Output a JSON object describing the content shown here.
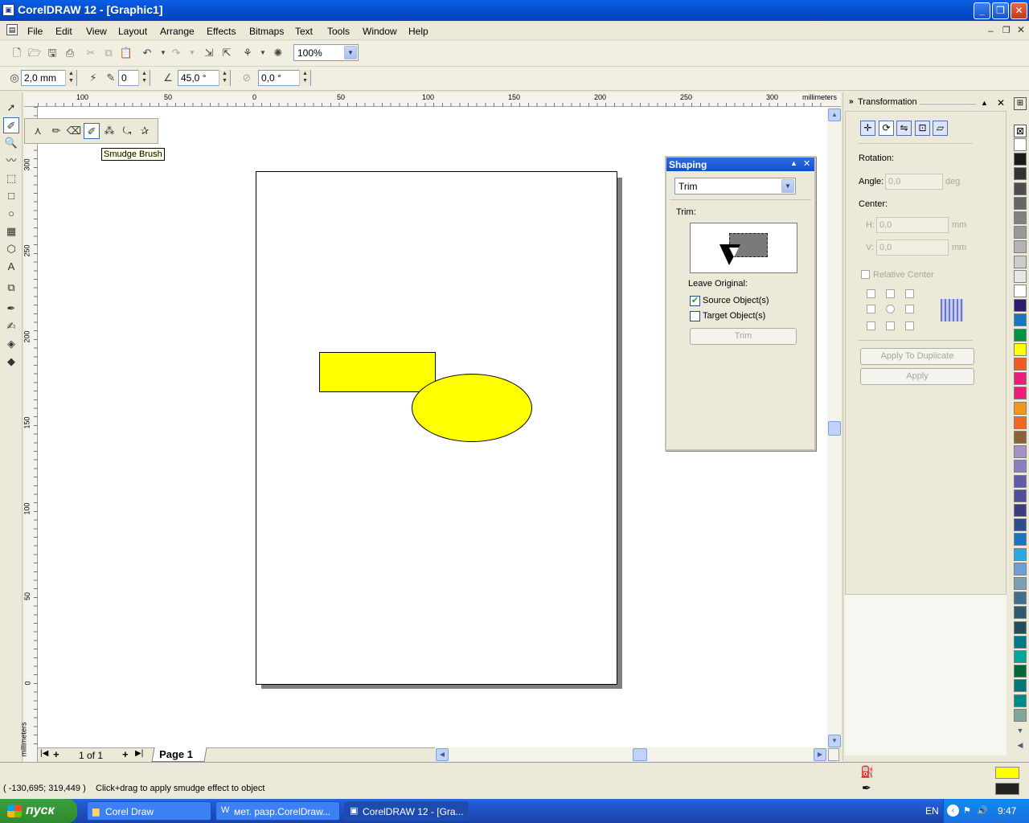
{
  "window": {
    "title": "CorelDRAW 12 - [Graphic1]",
    "min": "_",
    "max": "❐",
    "close": "✕"
  },
  "menu": [
    {
      "label": "File"
    },
    {
      "label": "Edit"
    },
    {
      "label": "View"
    },
    {
      "label": "Layout"
    },
    {
      "label": "Arrange"
    },
    {
      "label": "Effects"
    },
    {
      "label": "Bitmaps"
    },
    {
      "label": "Text"
    },
    {
      "label": "Tools"
    },
    {
      "label": "Window"
    },
    {
      "label": "Help"
    }
  ],
  "standard_toolbar": {
    "zoom_value": "100%"
  },
  "property_bar": {
    "nib_size": "2,0 mm",
    "dryout": "0",
    "tilt": "45,0 °",
    "bearing": "0,0 °"
  },
  "hruler": {
    "ticks": [
      "100",
      "50",
      "0",
      "50",
      "100",
      "150",
      "200",
      "250",
      "300"
    ],
    "units": "millimeters"
  },
  "vruler": {
    "ticks": [
      "300",
      "250",
      "200",
      "150",
      "100",
      "50",
      "0"
    ],
    "units": "millimeters"
  },
  "flyout": {
    "tooltip": "Smudge Brush"
  },
  "shaping": {
    "title": "Shaping",
    "mode": "Trim",
    "section": "Trim:",
    "leave_original": "Leave Original:",
    "source_label": "Source Object(s)",
    "source_checked": true,
    "target_label": "Target Object(s)",
    "target_checked": false,
    "trim_button": "Trim"
  },
  "transformation": {
    "title": "Transformation",
    "rotation": "Rotation:",
    "angle_label": "Angle:",
    "angle_value": "0,0",
    "angle_unit": "deg",
    "center": "Center:",
    "h_label": "H:",
    "h_value": "0,0",
    "v_label": "V:",
    "v_value": "0,0",
    "unit": "mm",
    "relative_center": "Relative Center",
    "apply_duplicate": "Apply To Duplicate",
    "apply": "Apply"
  },
  "page_nav": {
    "count": "1 of 1",
    "tab": "Page 1"
  },
  "status": {
    "coords": "( -130,695; 319,449 )",
    "hint": "Click+drag to apply smudge effect to object",
    "fill_color": "#ffff00",
    "outline_color": "#222222"
  },
  "palette": [
    "#ffffff",
    "#1a1a1a",
    "#333333",
    "#4d4d4d",
    "#666666",
    "#808080",
    "#999999",
    "#b3b3b3",
    "#cccccc",
    "#e6e6e6",
    "#ffffff",
    "#2e1a6e",
    "#1b75bc",
    "#009444",
    "#ffff00",
    "#f15a24",
    "#ed1e79",
    "#ed1e79",
    "#f7941d",
    "#f26522",
    "#8c6239",
    "#a593c5",
    "#8781bd",
    "#605ca8",
    "#524e9c",
    "#3c3c82",
    "#2e4c8f",
    "#1c75bc",
    "#27aae1",
    "#6d9fd4",
    "#7a9fb6",
    "#406e8e",
    "#2e5a6f",
    "#1f4e5a",
    "#007a87",
    "#00a79d",
    "#006837",
    "#00787a",
    "#008b8b",
    "#83a599"
  ],
  "taskbar": {
    "start": "пуск",
    "tasks": [
      {
        "label": "Corel Draw"
      },
      {
        "label": "мет. разр.CorelDraw..."
      },
      {
        "label": "CorelDRAW 12 - [Gra..."
      }
    ],
    "lang": "EN",
    "time": "9:47"
  }
}
